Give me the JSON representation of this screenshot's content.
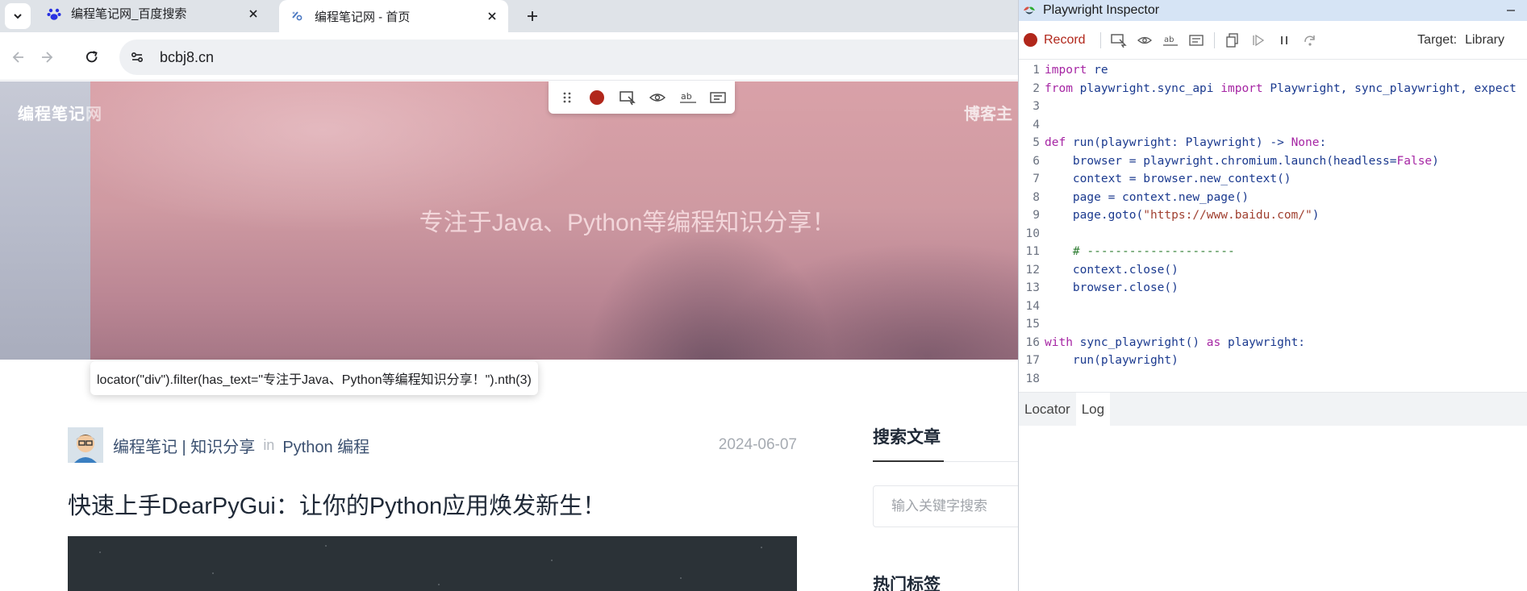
{
  "browser": {
    "tabs": [
      {
        "title": "编程笔记网_百度搜索",
        "favicon": "baidu-paw-icon",
        "active": false
      },
      {
        "title": "编程笔记网 - 首页",
        "favicon": "site-logo-icon",
        "active": true
      }
    ],
    "address": "bcbj8.cn"
  },
  "site": {
    "brand": "编程笔记",
    "brand_tail": "网",
    "blogger_label": "博客主",
    "slogan": "专注于Java、Python等编程知识分享！",
    "post": {
      "author": "编程笔记 | 知识分享",
      "in_label": "in",
      "category": "Python 编程",
      "date": "2024-06-07",
      "title": "快速上手DearPyGui：让你的Python应用焕发新生！"
    },
    "sidebar": {
      "search_title": "搜索文章",
      "search_placeholder": "输入关键字搜索",
      "tags_title": "热门标签"
    }
  },
  "locator_tooltip": "locator(\"div\").filter(has_text=\"专注于Java、Python等编程知识分享！\").nth(3)",
  "inspector": {
    "window_title": "Playwright Inspector",
    "record_label": "Record",
    "target_label": "Target:",
    "target_value": "Library",
    "code_lines": [
      "import re",
      "from playwright.sync_api import Playwright, sync_playwright, expect",
      "",
      "",
      "def run(playwright: Playwright) -> None:",
      "    browser = playwright.chromium.launch(headless=False)",
      "    context = browser.new_context()",
      "    page = context.new_page()",
      "    page.goto(\"https://www.baidu.com/\")",
      "",
      "    # ---------------------",
      "    context.close()",
      "    browser.close()",
      "",
      "",
      "with sync_playwright() as playwright:",
      "    run(playwright)",
      ""
    ],
    "line_numbers": [
      "1",
      "2",
      "3",
      "4",
      "5",
      "6",
      "7",
      "8",
      "9",
      "10",
      "11",
      "12",
      "13",
      "14",
      "15",
      "16",
      "17",
      "18"
    ],
    "bottom_tabs": [
      "Locator",
      "Log"
    ],
    "active_bottom_tab": "Log"
  },
  "colors": {
    "record_red": "#b1271b",
    "keyword": "#a626a4",
    "string": "#a04030",
    "code_default": "#1b3a8f",
    "comment": "#2e7d32"
  }
}
